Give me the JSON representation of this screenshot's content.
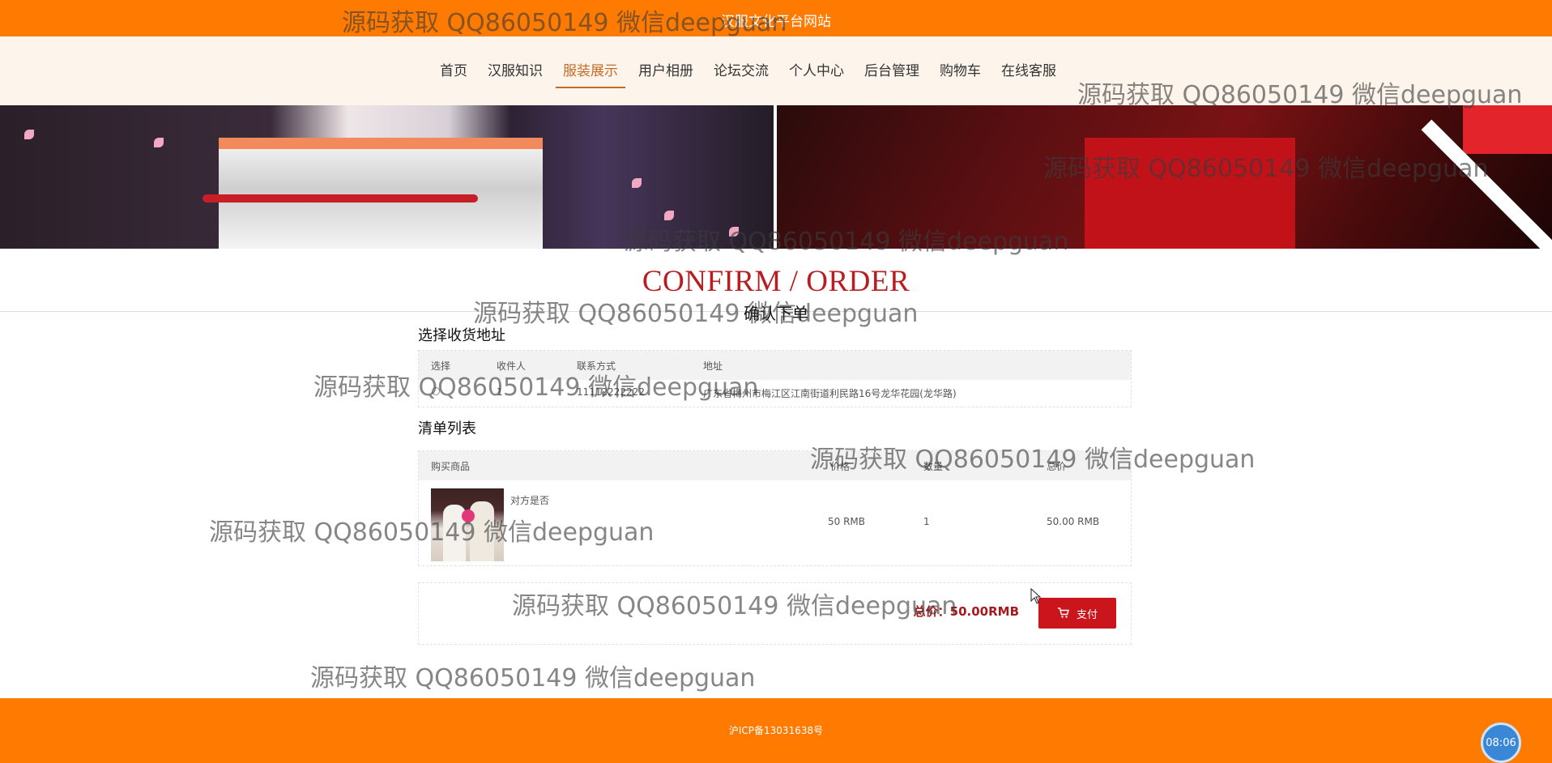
{
  "header": {
    "site_title": "汉服文化平台网站"
  },
  "nav": {
    "items": [
      {
        "label": "首页"
      },
      {
        "label": "汉服知识"
      },
      {
        "label": "服装展示"
      },
      {
        "label": "用户相册"
      },
      {
        "label": "论坛交流"
      },
      {
        "label": "个人中心"
      },
      {
        "label": "后台管理"
      },
      {
        "label": "购物车"
      },
      {
        "label": "在线客服"
      }
    ],
    "active": "服装展示"
  },
  "main": {
    "heading_en": "CONFIRM / ORDER",
    "heading_cn": "确认下单",
    "address_section": {
      "label": "选择收货地址",
      "columns": [
        "选择",
        "收件人",
        "联系方式",
        "地址"
      ],
      "rows": [
        {
          "recipient": "1",
          "contact": "11112222222",
          "address": "广东省梅州市梅江区江南街道利民路16号龙华花园(龙华路)"
        }
      ]
    },
    "list_section": {
      "label": "清单列表",
      "columns": [
        "购买商品",
        "价格",
        "数量",
        "总价"
      ],
      "items": [
        {
          "name": "对方是否",
          "price": "50 RMB",
          "quantity": "1",
          "total": "50.00 RMB"
        }
      ]
    },
    "summary": {
      "total_text": "总价：50.00RMB",
      "pay_label": "支付"
    }
  },
  "footer": {
    "icp": "沪ICP备13031638号"
  },
  "clock": {
    "time": "08:06"
  },
  "watermark_text": "源码获取 QQ86050149 微信deepguan",
  "colors": {
    "brand_orange": "#ff7a00",
    "accent_red": "#c9151b",
    "heading_red": "#b81d22"
  }
}
